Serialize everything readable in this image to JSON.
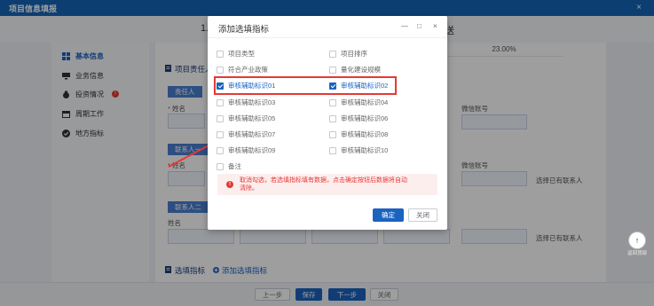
{
  "window": {
    "title": "项目信息填报",
    "close": "×"
  },
  "steps": {
    "left": "1.",
    "right": "送"
  },
  "sidebar": {
    "items": [
      {
        "label": "基本信息",
        "icon": "grid-icon"
      },
      {
        "label": "业务信息",
        "icon": "monitor-icon"
      },
      {
        "label": "投资情况",
        "icon": "money-bag-icon",
        "badge": "!"
      },
      {
        "label": "周期工作",
        "icon": "calendar-icon"
      },
      {
        "label": "地方指标",
        "icon": "check-circle-icon"
      }
    ]
  },
  "main": {
    "percent": "23.00%",
    "section_person": "项目责任人",
    "tag_responsible": "责任人",
    "tag_contact1": "联系人一",
    "tag_contact2": "联系人二",
    "name_label": "姓名",
    "wechat_label": "微信账号",
    "select_contact": "选择已有联系人",
    "section_indicator": "选填指标",
    "add_indicator": "添加选填指标"
  },
  "footer": {
    "prev": "上一步",
    "save": "保存",
    "next": "下一步",
    "close": "关闭"
  },
  "scroll_top": {
    "label": "返回顶部"
  },
  "dialog": {
    "title": "添加选填指标",
    "minimize": "—",
    "maximize": "□",
    "close": "×",
    "options_left": [
      {
        "label": "项目类型",
        "checked": false
      },
      {
        "label": "符合产业政策",
        "checked": false
      },
      {
        "label": "审核辅助标识01",
        "checked": true
      },
      {
        "label": "审核辅助标识03",
        "checked": false
      },
      {
        "label": "审核辅助标识05",
        "checked": false
      },
      {
        "label": "审核辅助标识07",
        "checked": false
      },
      {
        "label": "审核辅助标识09",
        "checked": false
      },
      {
        "label": "备注",
        "checked": false
      }
    ],
    "options_right": [
      {
        "label": "项目排序",
        "checked": false
      },
      {
        "label": "量化建设规模",
        "checked": false
      },
      {
        "label": "审核辅助标识02",
        "checked": true
      },
      {
        "label": "审核辅助标识04",
        "checked": false
      },
      {
        "label": "审核辅助标识06",
        "checked": false
      },
      {
        "label": "审核辅助标识08",
        "checked": false
      },
      {
        "label": "审核辅助标识10",
        "checked": false
      }
    ],
    "warning": "取消勾选，若选填指标填有数据，点击确定按钮后数据将自动清除。",
    "confirm": "确定",
    "close_btn": "关闭"
  },
  "colors": {
    "primary": "#1a63c0",
    "highlight": "#e53935",
    "titlebar": "#1565b8"
  }
}
